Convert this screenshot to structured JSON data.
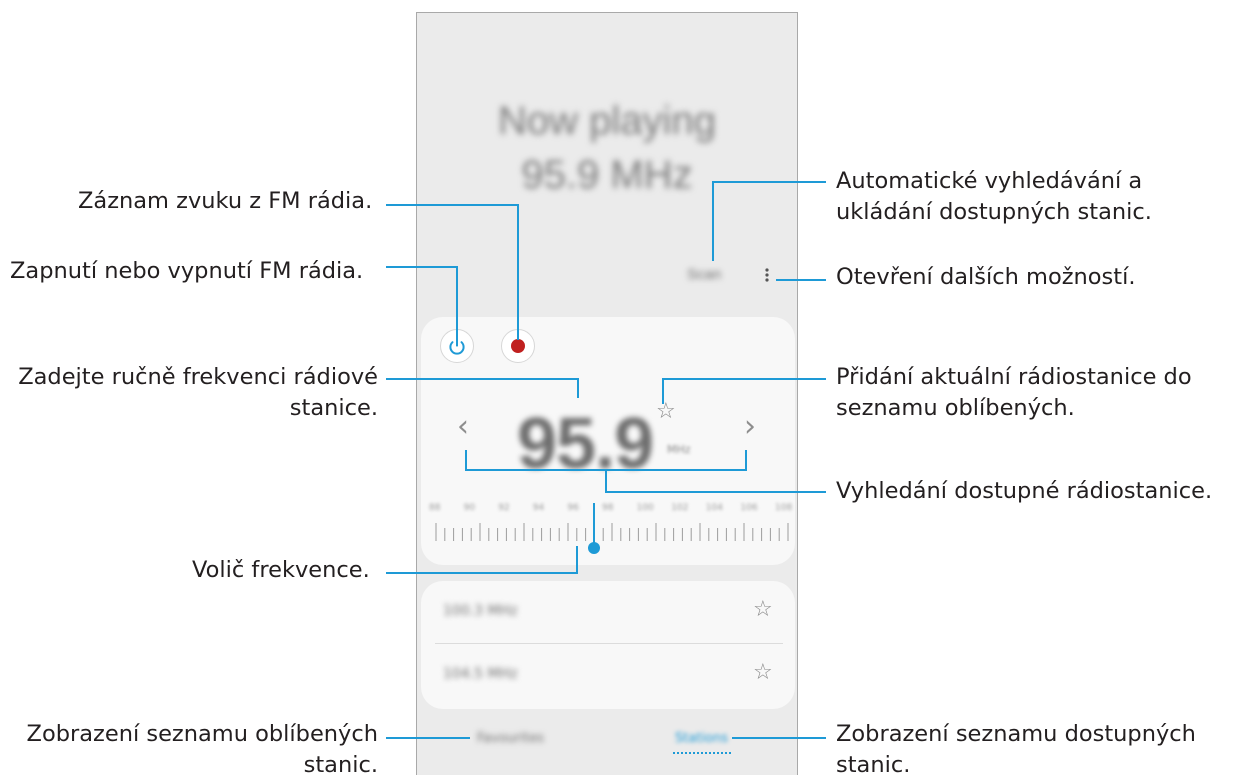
{
  "screen": {
    "now_playing_line1": "Now playing",
    "now_playing_line2": "95.9 MHz",
    "scan_label": "Scan",
    "more_icon": "three-dot-vertical-icon",
    "power_icon": "power-icon",
    "record_icon": "record-icon",
    "frequency_value": "95.9",
    "frequency_unit": "MHz",
    "favorite_icon": "star-outline-icon",
    "prev_icon": "chevron-left-icon",
    "next_icon": "chevron-right-icon",
    "scale_labels": [
      "88",
      "90",
      "92",
      "94",
      "96",
      "98",
      "100",
      "102",
      "104",
      "106",
      "108"
    ],
    "current_level": 0.45,
    "station_list": [
      {
        "freq": "100.3 MHz",
        "icon": "star-outline-icon"
      },
      {
        "freq": "104.5 MHz",
        "icon": "star-outline-icon"
      }
    ],
    "tabs": {
      "favourites": "Favourites",
      "stations": "Stations"
    },
    "colors": {
      "accent": "#1e9ad6",
      "record": "#c0201f",
      "screen_bg": "#ebebeb",
      "card_bg": "#f8f8f8"
    }
  },
  "callouts": {
    "record": "Záznam zvuku z FM rádia.",
    "power": "Zapnutí nebo vypnutí FM rádia.",
    "manual_line1": "Zadejte ručně frekvenci rádiové",
    "manual_line2": "stanice.",
    "tuner": "Volič frekvence.",
    "fav_list_line1": "Zobrazení seznamu oblíbených",
    "fav_list_line2": "stanic.",
    "autoscan_line1": "Automatické vyhledávání a",
    "autoscan_line2": "ukládání dostupných stanic.",
    "more_options": "Otevření dalších možností.",
    "add_fav_line1": "Přidání aktuální rádiostanice do",
    "add_fav_line2": "seznamu oblíbených.",
    "search": "Vyhledání dostupné rádiostanice.",
    "station_list_line1": "Zobrazení seznamu dostupných",
    "station_list_line2": "stanic."
  }
}
